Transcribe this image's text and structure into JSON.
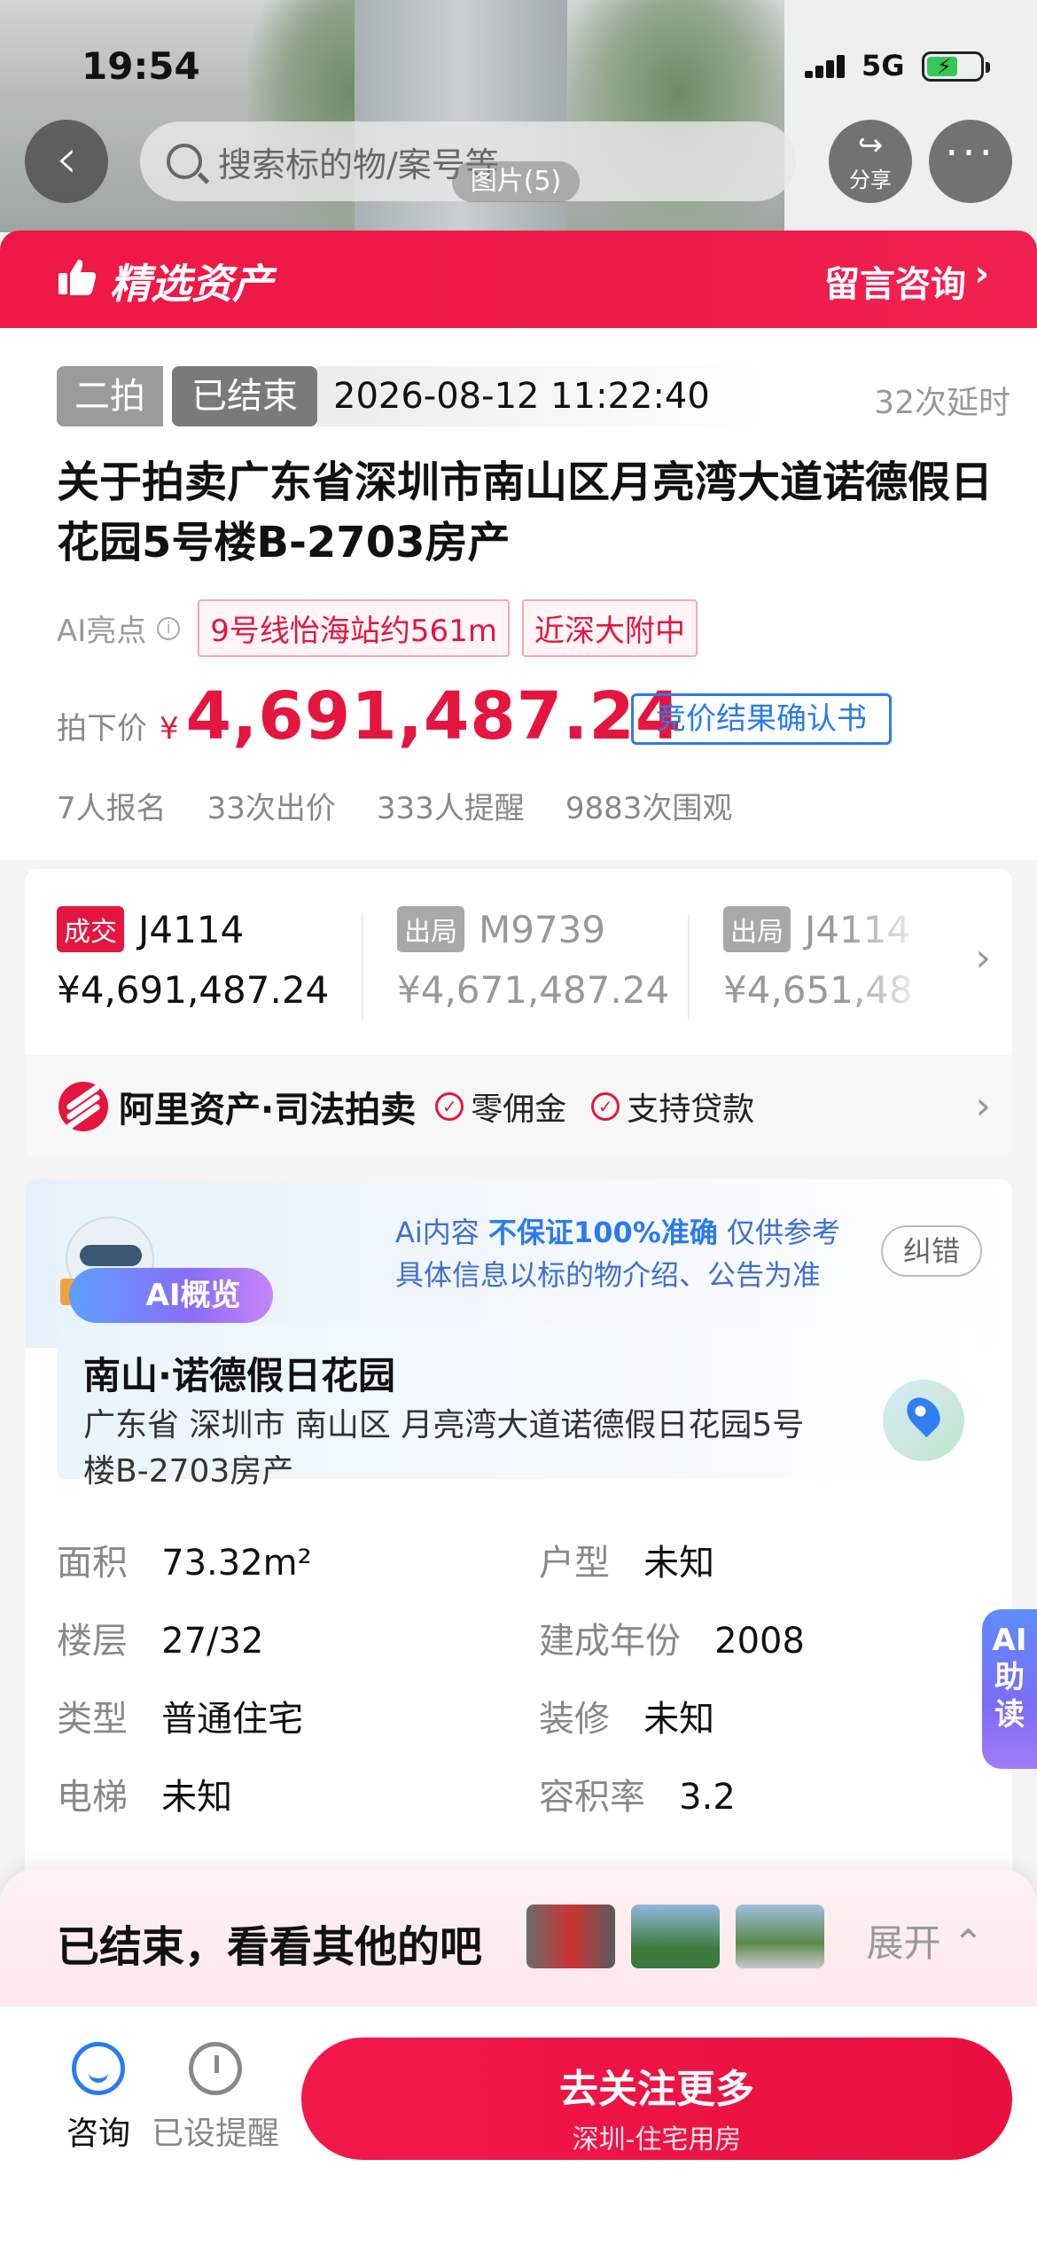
{
  "status_bar": {
    "time": "19:54",
    "network": "5G"
  },
  "nav": {
    "search_placeholder": "搜索标的物/案号等",
    "share_label": "分享",
    "more_label": "···",
    "back_icon": "chevron-left-icon",
    "image_count": "图片(5)"
  },
  "banner": {
    "title": "精选资产",
    "consult": "留言咨询",
    "chevron": "›",
    "bg_color": "#ef1745"
  },
  "auction": {
    "round_tag": "二拍",
    "status_tag": "已结束",
    "end_time": "2026-08-12 11:22:40",
    "delay_count": "32次延时",
    "title": "关于拍卖广东省深圳市南山区月亮湾大道诺德假日花园5号楼B-2703房产",
    "ai_label": "AI亮点",
    "ai_tags": [
      "9号线怡海站约561m",
      "近深大附中"
    ],
    "price_label": "拍下价",
    "currency": "¥",
    "price": "4,691,487.24",
    "confirm_doc": "竞价结果确认书",
    "stats": [
      "7人报名",
      "33次出价",
      "333人提醒",
      "9883次围观"
    ]
  },
  "bids": [
    {
      "badge": "成交",
      "code": "J4114",
      "price": "¥4,691,487.24",
      "won": true
    },
    {
      "badge": "出局",
      "code": "M9739",
      "price": "¥4,671,487.24",
      "won": false
    },
    {
      "badge": "出局",
      "code": "J4114",
      "price": "¥4,651,48",
      "won": false
    }
  ],
  "platform": {
    "name": "阿里资产·司法拍卖",
    "features": [
      "零佣金",
      "支持贷款"
    ]
  },
  "ai_overview": {
    "label": "AI概览",
    "disclaimer_line1_prefix": "Ai内容",
    "disclaimer_line1_bold": "不保证100%准确",
    "disclaimer_line1_suffix": "仅供参考",
    "disclaimer_line2": "具体信息以标的物介绍、公告为准",
    "correct_button": "纠错",
    "property_name": "南山·诺德假日花园",
    "address": "广东省 深圳市 南山区 月亮湾大道诺德假日花园5号楼B-2703房产",
    "details": [
      {
        "key": "面积",
        "value": "73.32m²"
      },
      {
        "key": "户型",
        "value": "未知"
      },
      {
        "key": "楼层",
        "value": "27/32"
      },
      {
        "key": "建成年份",
        "value": "2008"
      },
      {
        "key": "类型",
        "value": "普通住宅"
      },
      {
        "key": "装修",
        "value": "未知"
      },
      {
        "key": "电梯",
        "value": "未知"
      },
      {
        "key": "容积率",
        "value": "3.2"
      }
    ]
  },
  "ai_side_tab": {
    "line1": "AI",
    "line2": "助",
    "line3": "读"
  },
  "bottom": {
    "ended_text": "已结束，看看其他的吧",
    "expand_label": "展开 ⌃",
    "consult_label": "咨询",
    "reminder_label": "已设提醒",
    "cta_title": "去关注更多",
    "cta_subtitle": "深圳-住宅用房"
  }
}
